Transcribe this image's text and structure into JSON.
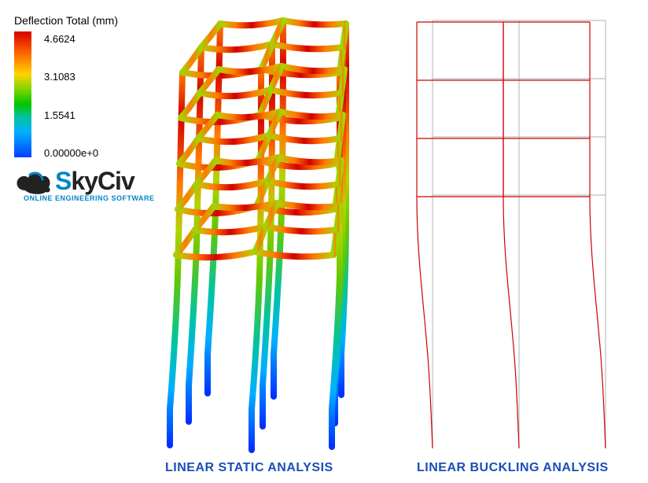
{
  "legend": {
    "title": "Deflection Total (mm)",
    "labels": [
      "4.6624",
      "3.1083",
      "1.5541",
      "0.00000e+0"
    ]
  },
  "logo": {
    "name": "SkyCiv",
    "subtitle": "ONLINE ENGINEERING SOFTWARE",
    "accent_color": "#0085c8"
  },
  "captions": {
    "left": "LINEAR STATIC ANALYSIS",
    "right": "LINEAR BUCKLING ANALYSIS"
  },
  "colors": {
    "red": "#d30000",
    "orange": "#ff7a00",
    "yellow": "#f0d000",
    "green": "#64c800",
    "cyan": "#00c4d4",
    "blue": "#0030ff",
    "grey": "#bfbfbf",
    "buckred": "#d10000"
  }
}
